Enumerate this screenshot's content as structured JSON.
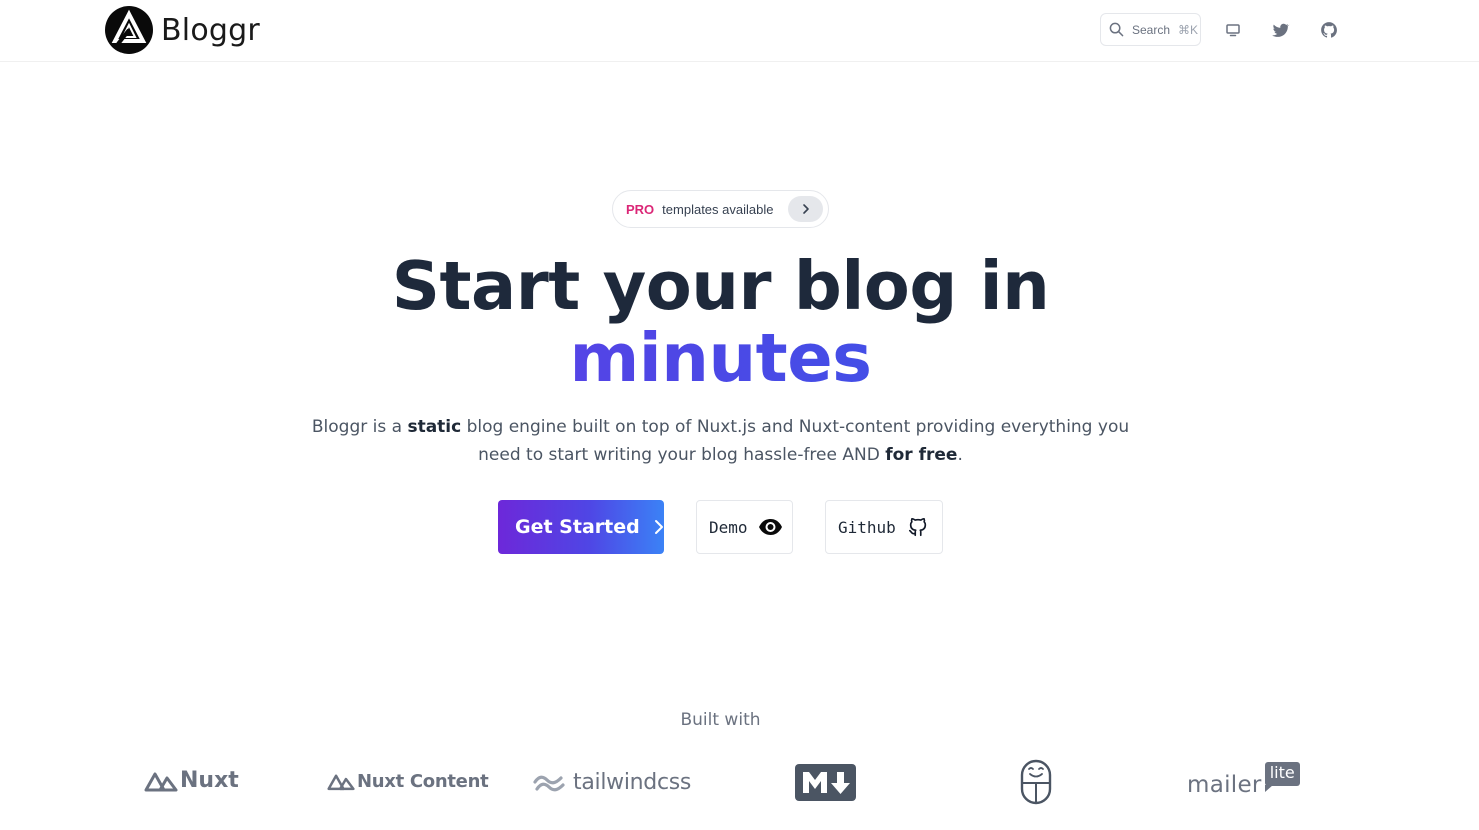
{
  "brand": {
    "name": "Bloggr"
  },
  "header": {
    "search_label": "Search",
    "search_shortcut": "⌘K",
    "icons": [
      "monitor-icon",
      "twitter-icon",
      "github-icon"
    ]
  },
  "pro_badge": {
    "tag": "PRO",
    "text": "templates available"
  },
  "hero": {
    "title_line1": "Start your blog in",
    "title_line2": "minutes",
    "desc_part1": "Bloggr is a ",
    "desc_bold1": "static",
    "desc_part2": " blog engine built on top of Nuxt.js and Nuxt-content providing everything you need to start writing your blog hassle-free AND ",
    "desc_bold2": "for free",
    "desc_part3": "."
  },
  "buttons": {
    "get_started": "Get Started",
    "demo": "Demo",
    "github": "Github"
  },
  "built_with": {
    "label": "Built with",
    "logos": {
      "nuxt": "Nuxt",
      "nuxt_content": "Nuxt Content",
      "tailwind": "tailwindcss",
      "mailer": "mailer",
      "mailer_badge": "lite"
    }
  },
  "colors": {
    "accent_start": "#7c3aed",
    "accent_end": "#2563eb",
    "pro": "#db2777",
    "title": "#1e293b",
    "muted": "#6b7280"
  }
}
